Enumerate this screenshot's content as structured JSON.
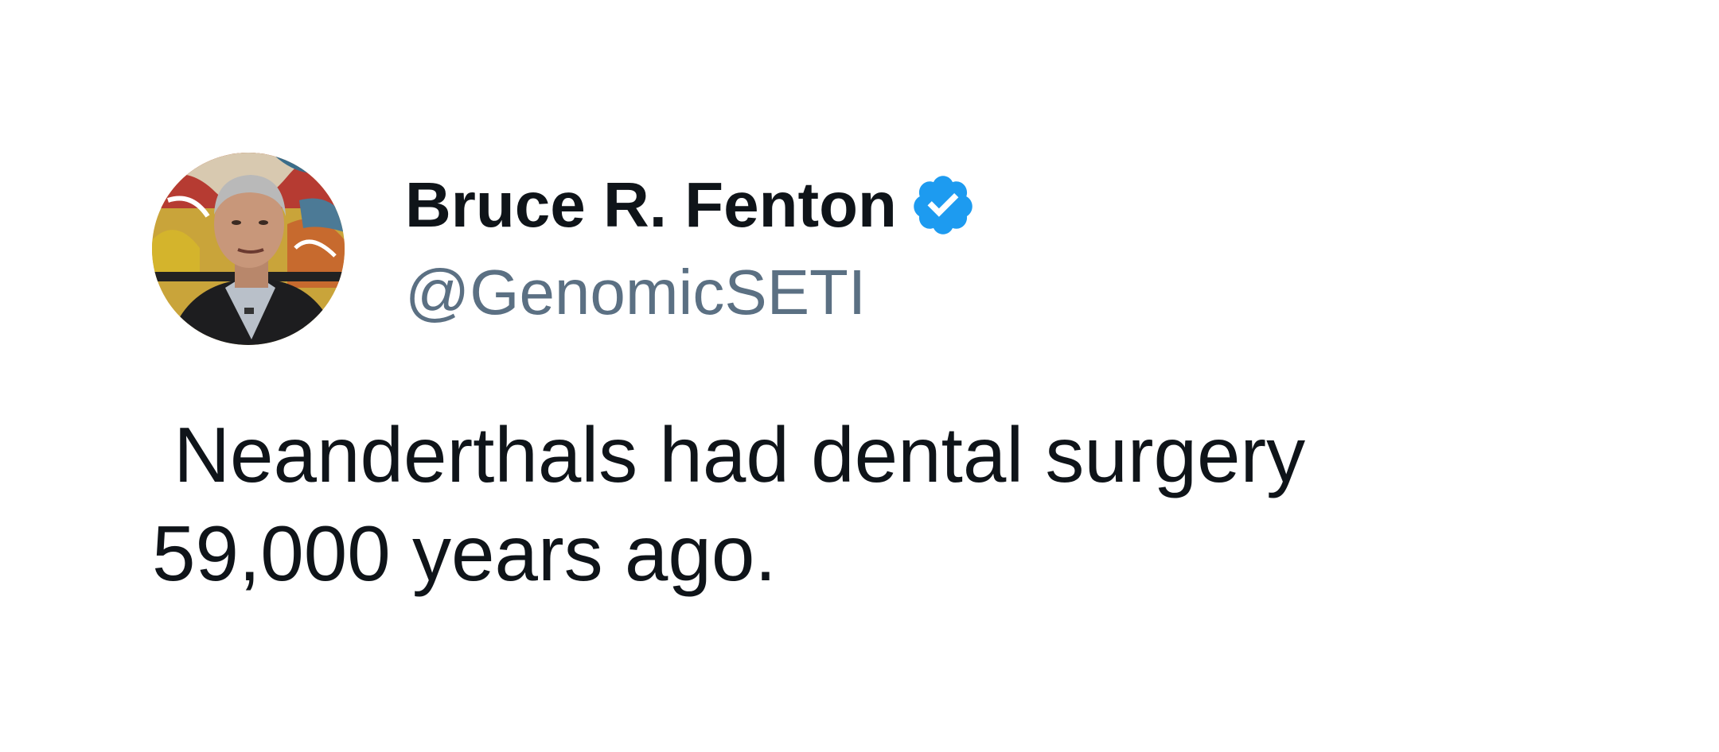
{
  "author": {
    "display_name": "Bruce R. Fenton",
    "handle": "@GenomicSETI",
    "verified_icon": "verified-badge-icon",
    "avatar": "profile-photo"
  },
  "tweet": {
    "line1": " Neanderthals had dental surgery",
    "line2": "59,000 years ago."
  },
  "colors": {
    "text": "#0f1419",
    "handle": "#5b7083",
    "verified": "#1d9bf0",
    "background": "#ffffff"
  }
}
